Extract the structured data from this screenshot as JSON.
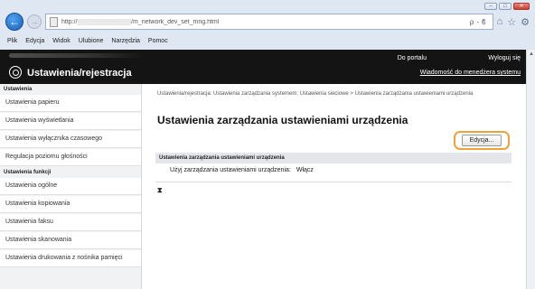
{
  "browser": {
    "url": "http://",
    "url_tail": "/m_network_dev_set_mng.html",
    "address_tools": "ρ-ϐ",
    "menu": [
      "Plik",
      "Edycja",
      "Widok",
      "Ulubione",
      "Narzędzia",
      "Pomoc"
    ]
  },
  "header": {
    "title": "Ustawienia/rejestracja",
    "link_portal": "Do portalu",
    "link_logout": "Wyloguj się",
    "link_message": "Wiadomość do menedżera systemu"
  },
  "sidebar": {
    "section1": "Ustawienia",
    "items1": [
      "Ustawienia papieru",
      "Ustawienia wyświetlania",
      "Ustawienia wyłącznika czasowego",
      "Regulacja poziomu głośności"
    ],
    "section2": "Ustawienia funkcji",
    "items2": [
      "Ustawienia ogólne",
      "Ustawienia kopiowania",
      "Ustawienia faksu",
      "Ustawienia skanowania",
      "Ustawienia drukowania z nośnika pamięci"
    ]
  },
  "main": {
    "breadcrumb": "Ustawienia/rejestracja: Ustawienia zarządzania systemem: Ustawienia sieciowe > Ustawienia zarządzania ustawieniami urządzenia",
    "title": "Ustawienia zarządzania ustawieniami urządzenia",
    "edit_button": "Edycja...",
    "panel_header": "Ustawienia zarządzania ustawieniami urządzenia",
    "row_label": "Użyj zarządzania ustawieniami urządzenia:",
    "row_value": "Włącz",
    "to_top": "⧗"
  },
  "colors": {
    "header_bg": "#141414",
    "edit_highlight": "#f0a23a"
  }
}
